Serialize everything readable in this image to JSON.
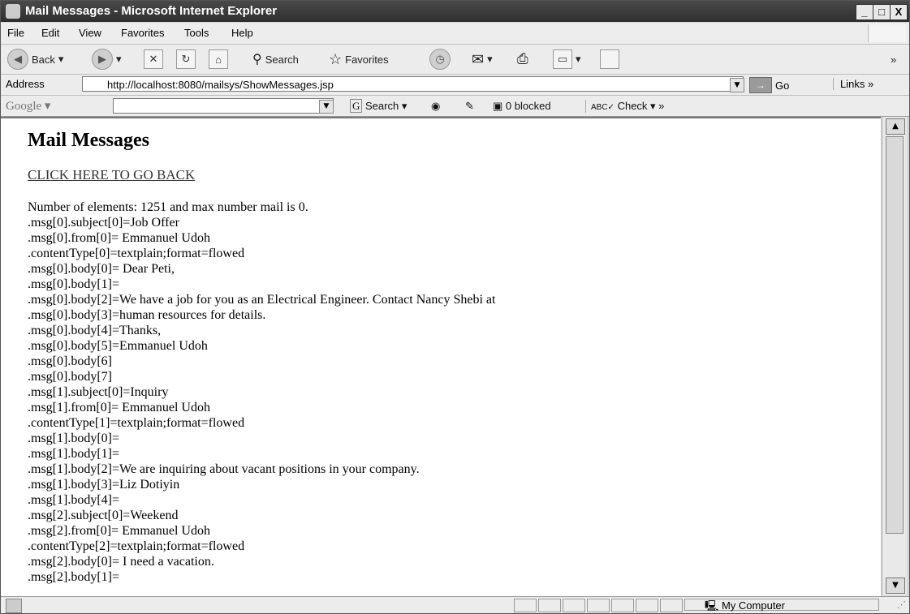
{
  "window": {
    "title": "Mail Messages - Microsoft Internet Explorer",
    "minimize": "_",
    "maximize": "□",
    "close": "X"
  },
  "menu": {
    "items": [
      "File",
      "Edit",
      "View",
      "Favorites",
      "Tools",
      "Help"
    ]
  },
  "toolbar": {
    "back": "Back",
    "search": "Search",
    "favorites": "Favorites"
  },
  "address": {
    "label": "Address",
    "url": "http://localhost:8080/mailsys/ShowMessages.jsp",
    "go": "Go",
    "links": "Links"
  },
  "google": {
    "logo": "Google",
    "search": "Search",
    "blocked": "0 blocked",
    "check": "Check"
  },
  "page": {
    "title": "Mail Messages",
    "back_link": "CLICK HERE TO GO BACK",
    "lines": [
      "Number of elements: 1251 and max number mail is 0.",
      ".msg[0].subject[0]=Job Offer",
      ".msg[0].from[0]= Emmanuel Udoh",
      ".contentType[0]=textplain;format=flowed",
      ".msg[0].body[0]= Dear Peti,",
      ".msg[0].body[1]=",
      ".msg[0].body[2]=We have a job for you as an Electrical Engineer. Contact Nancy Shebi at",
      ".msg[0].body[3]=human resources for details.",
      ".msg[0].body[4]=Thanks,",
      ".msg[0].body[5]=Emmanuel Udoh",
      ".msg[0].body[6]",
      ".msg[0].body[7]",
      ".msg[1].subject[0]=Inquiry",
      ".msg[1].from[0]= Emmanuel Udoh",
      ".contentType[1]=textplain;format=flowed",
      ".msg[1].body[0]=",
      ".msg[1].body[1]=",
      ".msg[1].body[2]=We are inquiring about vacant positions in your company.",
      ".msg[1].body[3]=Liz Dotiyin",
      ".msg[1].body[4]=",
      ".msg[2].subject[0]=Weekend",
      ".msg[2].from[0]= Emmanuel Udoh",
      ".contentType[2]=textplain;format=flowed",
      ".msg[2].body[0]= I need a vacation.",
      ".msg[2].body[1]="
    ]
  },
  "status": {
    "zone": "My Computer"
  }
}
